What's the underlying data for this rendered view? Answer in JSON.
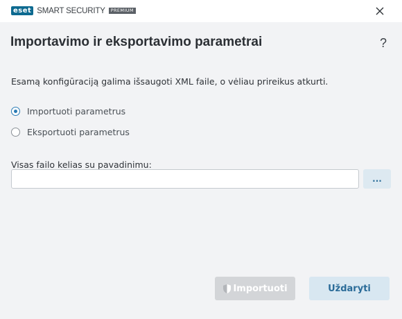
{
  "window": {
    "brand_logo": "eset",
    "product_name": "SMART SECURITY",
    "edition_badge": "PREMIUM",
    "close_icon": "close-icon"
  },
  "dialog": {
    "title": "Importavimo ir eksportavimo parametrai",
    "help_label": "?",
    "description": "Esamą konfigūraciją galima išsaugoti XML faile, o vėliau prireikus atkurti.",
    "options": [
      {
        "label": "Importuoti parametrus",
        "selected": true
      },
      {
        "label": "Eksportuoti parametrus",
        "selected": false
      }
    ],
    "path_field": {
      "label": "Visas failo kelias su pavadinimu:",
      "value": "",
      "placeholder": ""
    },
    "browse_label": "...",
    "import_button": {
      "label": "Importuoti",
      "icon": "shield-icon",
      "enabled": false
    },
    "close_button": {
      "label": "Uždaryti"
    }
  },
  "colors": {
    "accent": "#2a7bb5",
    "brand": "#0d6a90",
    "background": "#f2f3f5"
  }
}
